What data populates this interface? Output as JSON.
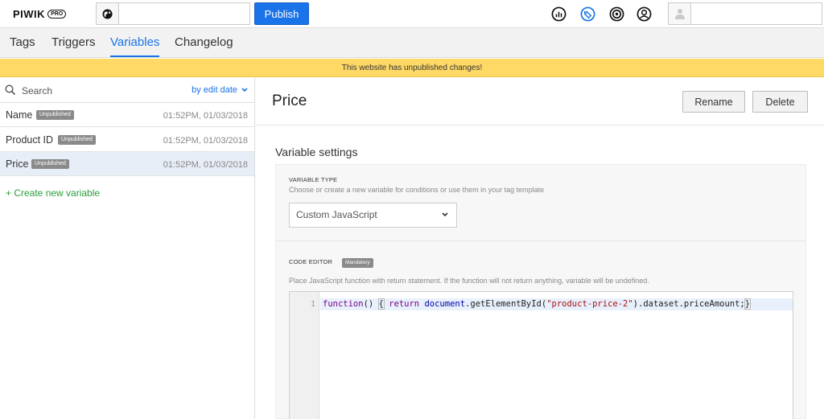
{
  "topbar": {
    "logo_text": "PIWIK",
    "logo_badge": "PRO",
    "site_input_value": "",
    "publish_label": "Publish",
    "icons": [
      "analytics-icon",
      "tag-manager-icon",
      "target-icon",
      "user-circle-icon"
    ],
    "user_input_value": ""
  },
  "tabs": [
    {
      "label": "Tags",
      "active": false
    },
    {
      "label": "Triggers",
      "active": false
    },
    {
      "label": "Variables",
      "active": true
    },
    {
      "label": "Changelog",
      "active": false
    }
  ],
  "banner": {
    "text": "This website has unpublished changes!"
  },
  "sidebar": {
    "search_placeholder": "Search",
    "sort_label": "by edit date",
    "items": [
      {
        "name": "Name",
        "badge": "Unpublished",
        "date": "01:52PM, 01/03/2018",
        "selected": false
      },
      {
        "name": "Product ID",
        "badge": "Unpublished",
        "date": "01:52PM, 01/03/2018",
        "selected": false
      },
      {
        "name": "Price",
        "badge": "Unpublished",
        "date": "01:52PM, 01/03/2018",
        "selected": true
      }
    ],
    "create_label": "+ Create new variable"
  },
  "main": {
    "title": "Price",
    "rename_label": "Rename",
    "delete_label": "Delete",
    "section_title": "Variable settings",
    "variable_type": {
      "label": "VARIABLE TYPE",
      "help": "Choose or create a new variable for conditions or use them in your tag template",
      "selected": "Custom JavaScript"
    },
    "code_editor": {
      "label": "CODE EDITOR",
      "badge": "Mandatory",
      "help": "Place JavaScript function with return statement. If the function will not return anything, variable will be undefined.",
      "line_number": "1",
      "code": {
        "t1": "function",
        "t2": "() ",
        "t3": "{",
        "t4": " ",
        "t5": "return",
        "t6": " ",
        "t7": "document",
        "t8": ".getElementById(",
        "t9": "\"product-price-2\"",
        "t10": ").dataset.priceAmount;",
        "t11": "}"
      }
    }
  },
  "colors": {
    "accent": "#1a73e8",
    "banner": "#ffd966",
    "create_link": "#2a9d3a",
    "badge": "#8a8a8a"
  }
}
